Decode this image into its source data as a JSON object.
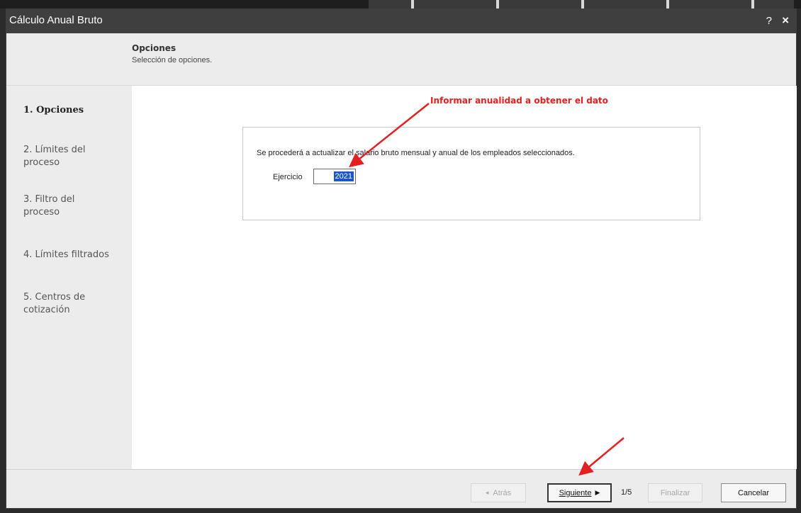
{
  "window": {
    "title": "Cálculo Anual Bruto",
    "help": "?",
    "close": "×"
  },
  "header": {
    "title": "Opciones",
    "subtitle": "Selección de opciones."
  },
  "steps": [
    {
      "label": "1. Opciones",
      "active": true
    },
    {
      "label": "2. Límites del proceso",
      "active": false
    },
    {
      "label": "3. Filtro del proceso",
      "active": false
    },
    {
      "label": "4. Límites filtrados",
      "active": false
    },
    {
      "label": "5. Centros de cotización",
      "active": false
    }
  ],
  "annotation": "Informar anualidad a obtener el dato",
  "options": {
    "description": "Se procederá a actualizar el salario bruto mensual y anual de los empleados seleccionados.",
    "ejercicio_label": "Ejercicio",
    "ejercicio_value": "2021"
  },
  "footer": {
    "back_label": "Atrás",
    "next_label": "Siguiente",
    "page_indicator": "1/5",
    "finish_label": "Finalizar",
    "cancel_label": "Cancelar"
  },
  "colors": {
    "annotation": "#e32020",
    "selection": "#1a56c8",
    "titlebar": "#3f3f3f"
  }
}
